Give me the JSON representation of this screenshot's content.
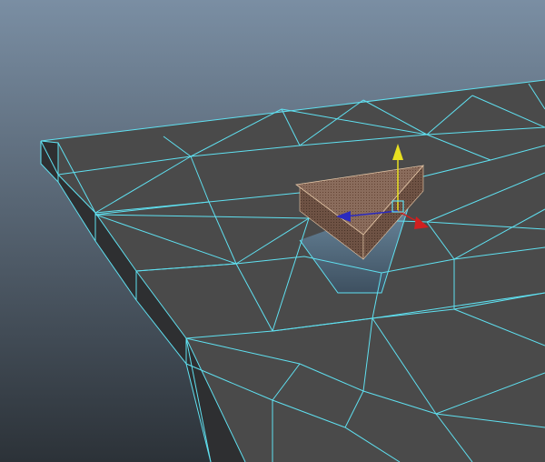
{
  "viewport": {
    "panel": "perspective",
    "background_top": "#7a8ea3",
    "background_bottom": "#2c3238",
    "wireframe_color": "#5fe0f0",
    "surface_color": "#4a4a4a",
    "side_color": "#2f3031"
  },
  "scene": {
    "ground_mesh": {
      "display": "wireframe-on-shaded",
      "selected": true
    },
    "selected_object": {
      "shape": "triangular prism",
      "color": "#8a6c5c",
      "component_mode": "vertex"
    }
  },
  "manipulator": {
    "tool": "move",
    "axes": [
      {
        "axis": "y",
        "color": "#e8e020"
      },
      {
        "axis": "x",
        "color": "#d02020"
      },
      {
        "axis": "z",
        "color": "#2a2ac0"
      }
    ]
  }
}
